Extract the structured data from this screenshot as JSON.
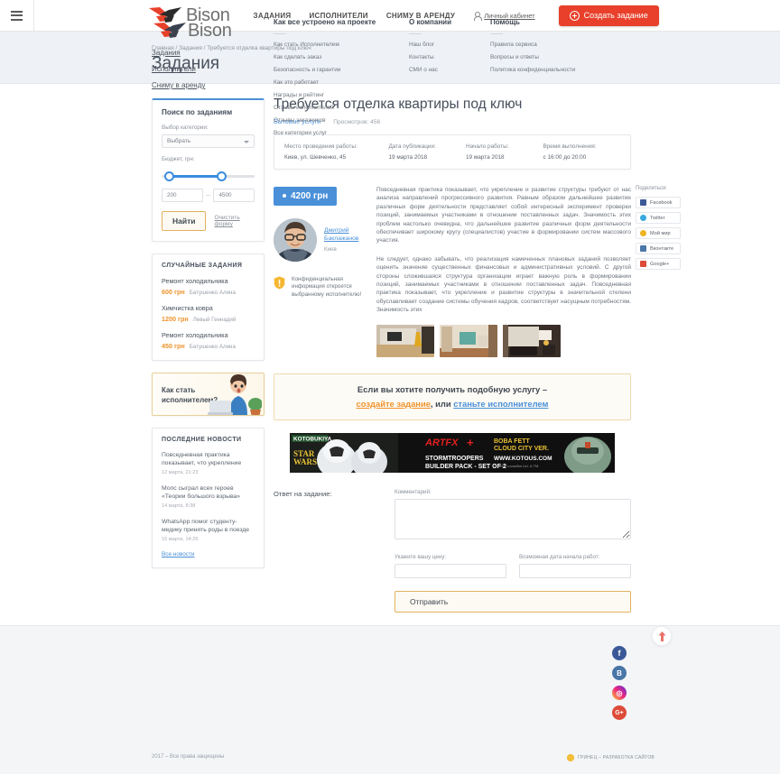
{
  "topbar": {
    "menu_icon": "hamburger-icon",
    "brand": "Bison",
    "nav": [
      {
        "label": "ЗАДАНИЯ"
      },
      {
        "label": "ИСПОЛНИТЕЛИ"
      },
      {
        "label": "СНИМУ В АРЕНДУ"
      }
    ],
    "cabinet": "Личный кабинет",
    "create_button": "Создать задание"
  },
  "pagehead": {
    "breadcrumb_home": "Главная",
    "breadcrumb_sep1": " / ",
    "breadcrumb_tasks": "Задания",
    "breadcrumb_sep2": " / ",
    "breadcrumb_current": "Требуется отделка квартиры под ключ",
    "title": "Задания"
  },
  "sidebar": {
    "search": {
      "title": "Поиск по заданиям",
      "category_label": "Выбор категории:",
      "category_value": "Выбрать",
      "budget_label": "Бюджет, грн:",
      "min_value": "200",
      "max_value": "4500",
      "dash": "–",
      "find_button": "Найти",
      "clear_link": "Очистить форму"
    },
    "random": {
      "title": "СЛУЧАЙНЫЕ ЗАДАНИЯ",
      "items": [
        {
          "name": "Ремонт холодильника",
          "price": "600 грн",
          "author": "Батушенко Алина"
        },
        {
          "name": "Химчистка ковра",
          "price": "1200 грн",
          "author": "Левый Геннадий"
        },
        {
          "name": "Ремонт холодильника",
          "price": "450 грн",
          "author": "Батушенко Алина"
        }
      ]
    },
    "promo": {
      "line1": "Как стать",
      "line2": "исполнителем?"
    },
    "news": {
      "title": "ПОСЛЕДНИЕ НОВОСТИ",
      "items": [
        {
          "title": "Повседневная практика показывает, что укрепление",
          "date": "12 марта, 21:23"
        },
        {
          "title": "Мопс сыграл всех героев «Теории большого взрыва»",
          "date": "14 марта, 8:38"
        },
        {
          "title": "WhatsApp помог студенту-медику принять роды в поезде",
          "date": "15 марта, 14:25"
        }
      ],
      "all_link": "Все новости"
    }
  },
  "task": {
    "title": "Требуется отделка квартиры под ключ",
    "category": "Бытовые услуги",
    "views": "Просмотров: 456",
    "meta": [
      {
        "key": "Место проведения работы:",
        "value": "Киев, ул. Шевченко, 45"
      },
      {
        "key": "Дата публикации:",
        "value": "19 марта 2018"
      },
      {
        "key": "Начало работы:",
        "value": "19 марта 2018"
      },
      {
        "key": "Время выполнения:",
        "value": "с 16:00 до 20:00"
      }
    ],
    "price": "4200 грн",
    "author_name_line1": "Дмитрий",
    "author_name_line2": "Баклажанов",
    "author_city": "Киев",
    "notice": "Конфиденциальная информация откроется выбранному исполнителю!",
    "paragraph1": "Повседневная практика показывает, что укрепление и развитие структуры требуют от нас анализа направлений прогрессивного развития. Равным образом дальнейшее развитие различных форм деятельности представляет собой интересный эксперимент проверки позиций, занимаемых участниками в отношении поставленных задач. Значимость этих проблем настолько очевидна, что дальнейшее развитие различных форм деятельности обеспечивает широкому кругу (специалистов) участие в формировании систем массового участия.",
    "paragraph2": "Не следует, однако забывать, что реализация намеченных плановых заданий позволяет оценить значение существенных финансовых и административных условий. С другой стороны сложившаяся структура организации играет важную роль в формировании позиций, занимаемых участниками в отношении поставленных задач. Повседневная практика показывает, что укрепление и развитие структуры в значительной степени обуславливает создание системы обучения кадров, соответствует насущным потребностям. Значимость этих"
  },
  "share": {
    "title": "Поделиться:",
    "buttons": [
      {
        "label": "Facebook",
        "color": "#3b5998",
        "glyph": "f"
      },
      {
        "label": "Twitter",
        "color": "#3ba9e0",
        "glyph": "t"
      },
      {
        "label": "Мой мир",
        "color": "#f0b323",
        "glyph": "@"
      },
      {
        "label": "Вконтакте",
        "color": "#4a76a8",
        "glyph": "B"
      },
      {
        "label": "Google+",
        "color": "#dd4b39",
        "glyph": "g"
      }
    ]
  },
  "cta": {
    "line1": "Если вы хотите получить подобную услугу –",
    "link_create": "создайте задание",
    "separator": ", или ",
    "link_become": "станьте исполнителем"
  },
  "ad": {
    "brand": "KOTOBUKIYA",
    "franchise": "STAR WARS",
    "series": "ARTFX+",
    "headline1": "BOBA FETT",
    "headline2": "CLOUD CITY VER.",
    "product1": "STORMTROOPERS",
    "product2": "BUILDER PACK - SET OF 2",
    "url": "WWW.KOTOUS.COM",
    "legal": "© 2018 Lucasfilm Ltd. & TM."
  },
  "form": {
    "section_label": "Ответ на задание:",
    "comment_label": "Комментарий:",
    "comment_value": "",
    "price_label": "Укажите вашу цену:",
    "price_value": "",
    "date_label": "Возможная дата начала работ:",
    "date_value": "",
    "submit": "Отправить"
  },
  "footer": {
    "brand": "Bison",
    "main_links": [
      {
        "label": "Задания"
      },
      {
        "label": "Исполнители"
      },
      {
        "label": "Сниму в аренду"
      }
    ],
    "copyright": "2017 – Все права защищены",
    "columns": [
      {
        "title": "Как все устроено на проекте",
        "links": [
          {
            "label": "Как стать Исполнителем"
          },
          {
            "label": "Как сделать заказ"
          },
          {
            "label": "Безопасность и гарантии"
          },
          {
            "label": "Как это работает"
          },
          {
            "label": "Награды и рейтинг"
          },
          {
            "label": "Отзывы исполнителей"
          },
          {
            "label": "Отзывы заказчиков"
          },
          {
            "label": "Все категории услуг"
          }
        ]
      },
      {
        "title": "О компании",
        "links": [
          {
            "label": "Наш блог"
          },
          {
            "label": "Контакты"
          },
          {
            "label": "СМИ о нас"
          }
        ]
      },
      {
        "title": "Помощь",
        "links": [
          {
            "label": "Правила сервиса"
          },
          {
            "label": "Вопросы и ответы"
          },
          {
            "label": "Политика конфиденциальности"
          }
        ]
      }
    ],
    "social": [
      {
        "name": "facebook",
        "glyph": "f",
        "color": "#3b5998"
      },
      {
        "name": "vk",
        "glyph": "B",
        "color": "#4a76a8"
      },
      {
        "name": "instagram",
        "glyph": "◎",
        "color": "#c13584"
      },
      {
        "name": "google-plus",
        "glyph": "G+",
        "color": "#dd4b39"
      }
    ],
    "developer": "ГРИНЕЦ – РАЗРАБОТКА САЙТОВ"
  },
  "colors": {
    "accent_red": "#e8402a",
    "accent_blue": "#4a90d9",
    "accent_orange": "#f0922b",
    "page_bg": "#eef1f5"
  }
}
